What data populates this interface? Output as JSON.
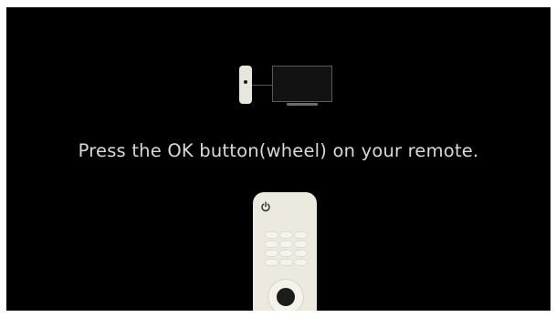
{
  "instruction": {
    "text": "Press the OK button(wheel) on your remote."
  },
  "icons": {
    "remote": "remote-control-icon",
    "tv": "tv-icon",
    "power": "power-icon",
    "ok_wheel": "ok-wheel-icon"
  },
  "colors": {
    "background": "#000000",
    "text": "#d9d9d9",
    "remote_body": "#ece9df"
  }
}
